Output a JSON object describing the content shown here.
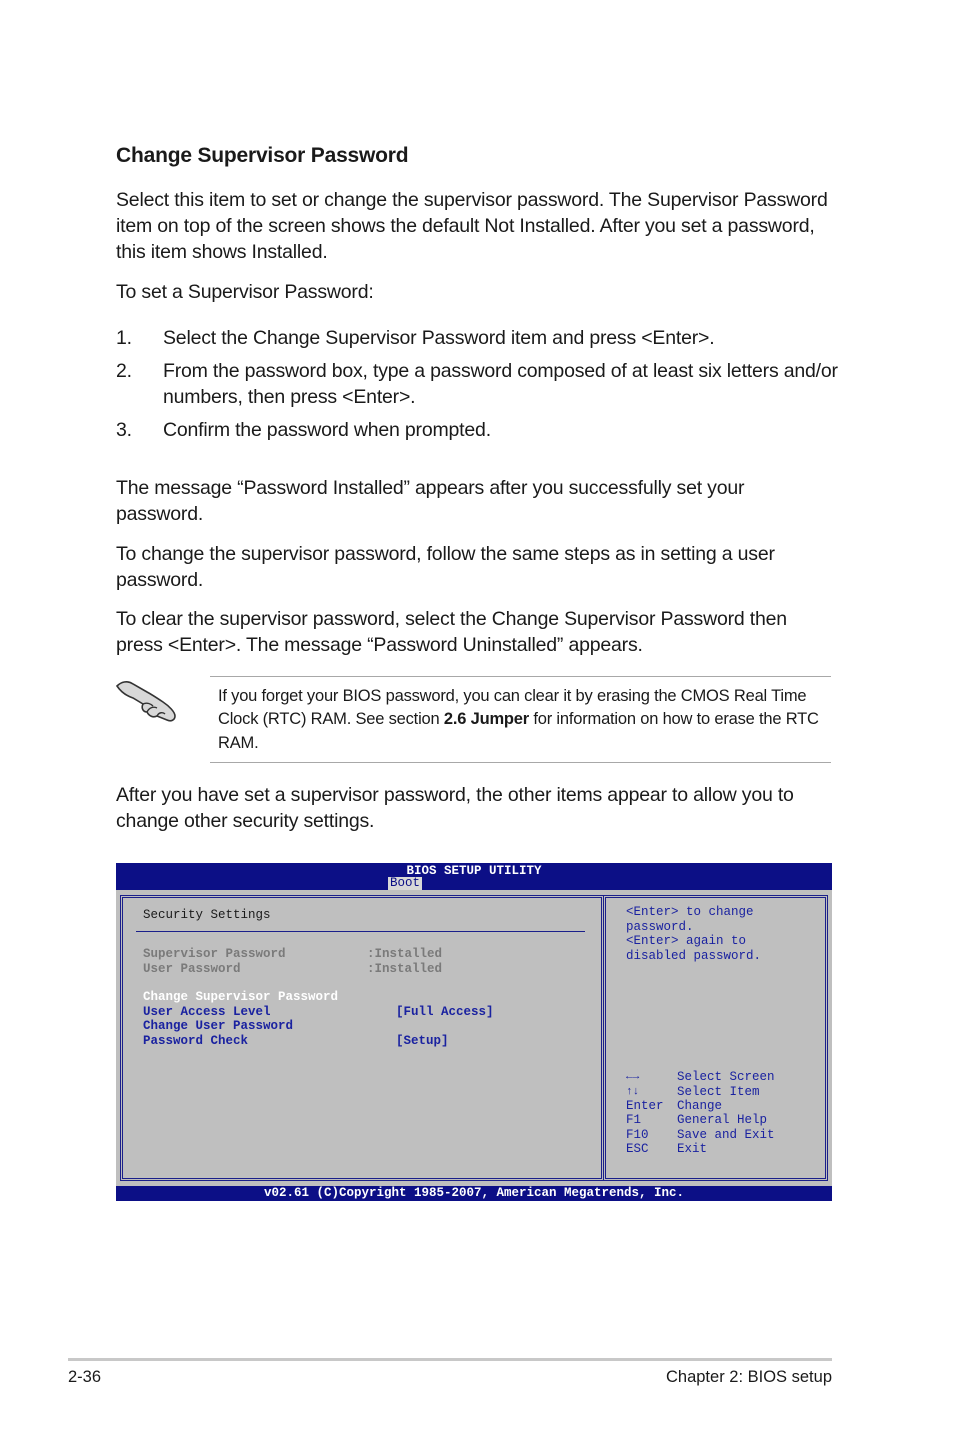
{
  "section": {
    "title": "Change Supervisor Password",
    "intro": "Select this item to set or change the supervisor password. The Supervisor Password item on top of the screen shows the default Not Installed. After you set a password, this item shows Installed.",
    "steps_heading": "To set a Supervisor Password:",
    "steps": [
      {
        "num": "1.",
        "text": "Select the Change Supervisor Password item and press <Enter>."
      },
      {
        "num": "2.",
        "text": "From the password box, type a password composed of at least six letters and/or numbers, then press <Enter>."
      },
      {
        "num": "3.",
        "text": "Confirm the password when prompted."
      }
    ],
    "para_installed": "The message “Password Installed” appears after you successfully set your password.",
    "para_change": "To change the supervisor password, follow the same steps as in setting a user password.",
    "para_clear": "To clear the supervisor password, select the Change Supervisor Password then press <Enter>. The message “Password Uninstalled” appears.",
    "note": {
      "icon": "pointing-hand-icon",
      "text_before": "If you forget your BIOS password, you can clear it by erasing the CMOS Real Time Clock (RTC) RAM. See section ",
      "text_bold": "2.6 Jumper",
      "text_after": " for information on how to erase the RTC RAM."
    },
    "para_after": "After you have set a supervisor password, the other items appear to allow you to change other security settings."
  },
  "bios": {
    "title": "BIOS SETUP UTILITY",
    "active_tab": "Boot",
    "heading": "Security Settings",
    "status_items": [
      {
        "label": "Supervisor Password",
        "value": ":Installed"
      },
      {
        "label": "User Password",
        "value": ":Installed"
      }
    ],
    "menu_items": [
      {
        "label": "Change Supervisor Password",
        "value": "",
        "selected": true
      },
      {
        "label": "User Access Level",
        "value": "[Full Access]"
      },
      {
        "label": "Change User Password",
        "value": ""
      },
      {
        "label": "Password Check",
        "value": "[Setup]"
      }
    ],
    "help_lines": [
      "<Enter> to change",
      "password.",
      "<Enter> again to",
      "disabled password."
    ],
    "keys": [
      {
        "key": "←→",
        "icon": "left-right-arrows-icon",
        "action": "Select Screen"
      },
      {
        "key": "↑↓",
        "icon": "up-down-arrows-icon",
        "action": "Select Item"
      },
      {
        "key": "Enter",
        "action": "Change"
      },
      {
        "key": "F1",
        "action": "General Help"
      },
      {
        "key": "F10",
        "action": "Save and Exit"
      },
      {
        "key": "ESC",
        "action": "Exit"
      }
    ],
    "copyright": "v02.61 (C)Copyright 1985-2007, American Megatrends, Inc.",
    "colors": {
      "header_blue": "#0c0f86",
      "panel_gray": "#bfbfbf",
      "item_blue": "#1a22a0"
    }
  },
  "footer": {
    "page": "2-36",
    "chapter": "Chapter 2: BIOS setup"
  }
}
